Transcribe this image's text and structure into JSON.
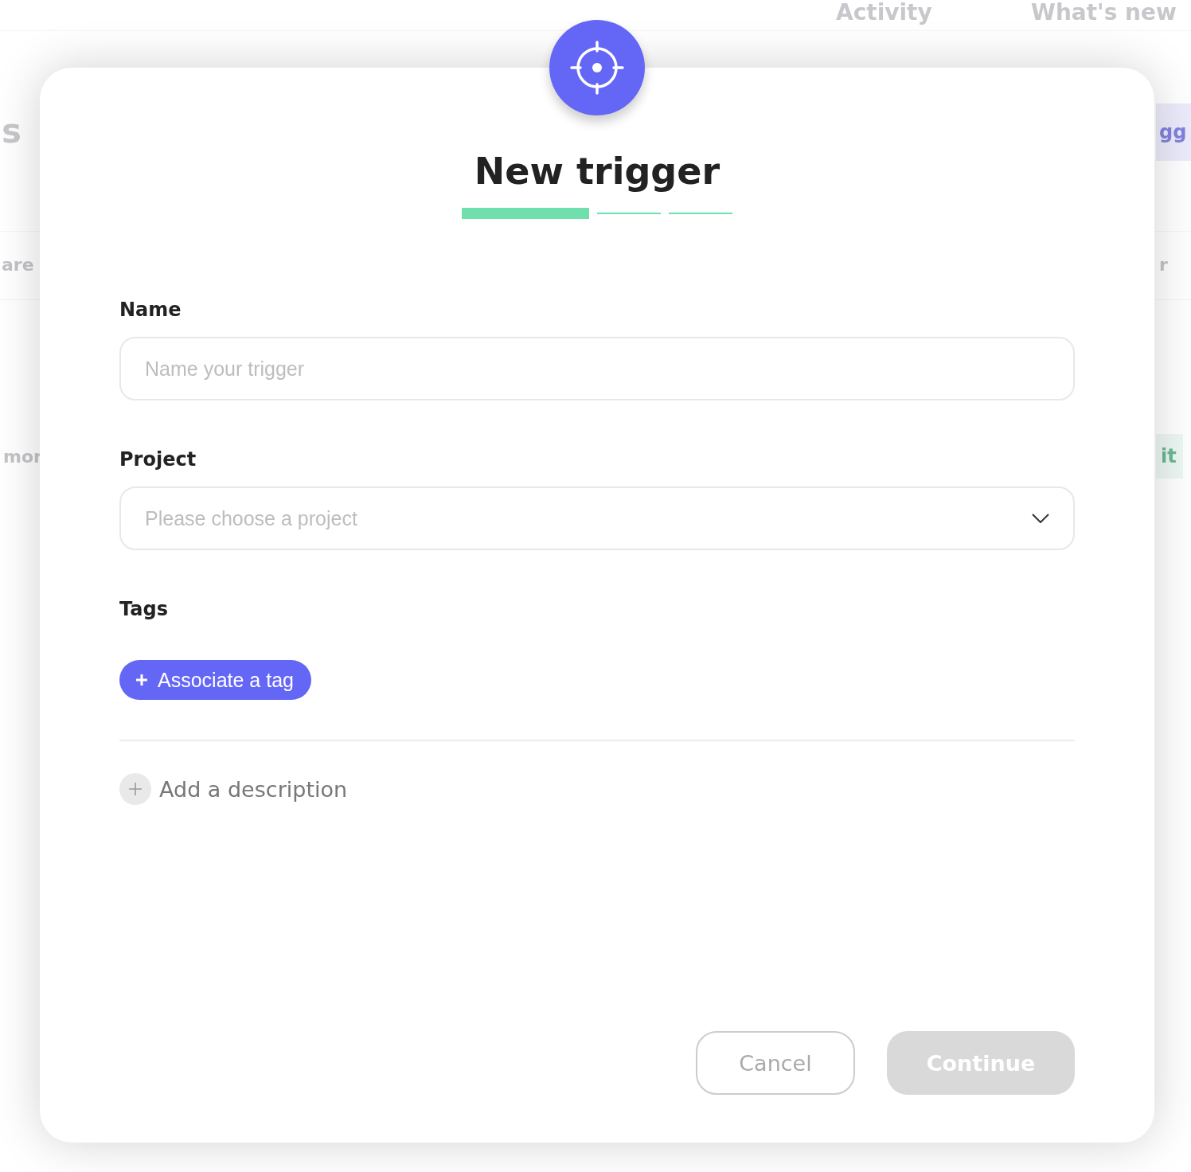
{
  "background": {
    "nav": [
      "Activity",
      "What's new"
    ],
    "fragments": [
      {
        "text": "s",
        "kind": "heading"
      },
      {
        "text": "are",
        "kind": "text"
      },
      {
        "text": "mor",
        "kind": "text"
      },
      {
        "text": "gg",
        "kind": "button"
      },
      {
        "text": "r",
        "kind": "text"
      },
      {
        "text": "it",
        "kind": "success"
      }
    ]
  },
  "dialog": {
    "title": "New trigger",
    "steps": [
      {
        "selected": true
      },
      {
        "selected": false
      },
      {
        "selected": false
      }
    ],
    "fields": [
      {
        "label": "Name",
        "kind": "text",
        "placeholder": "Name your trigger"
      },
      {
        "label": "Project",
        "kind": "select",
        "placeholder": "Please choose a project"
      }
    ],
    "tags": {
      "label": "Tags",
      "button": "Associate a tag"
    },
    "description": {
      "label": "Add a description"
    },
    "buttons": [
      {
        "label": "Cancel",
        "kind": "secondary",
        "disabled": false
      },
      {
        "label": "Continue",
        "kind": "primary",
        "disabled": true
      }
    ]
  }
}
